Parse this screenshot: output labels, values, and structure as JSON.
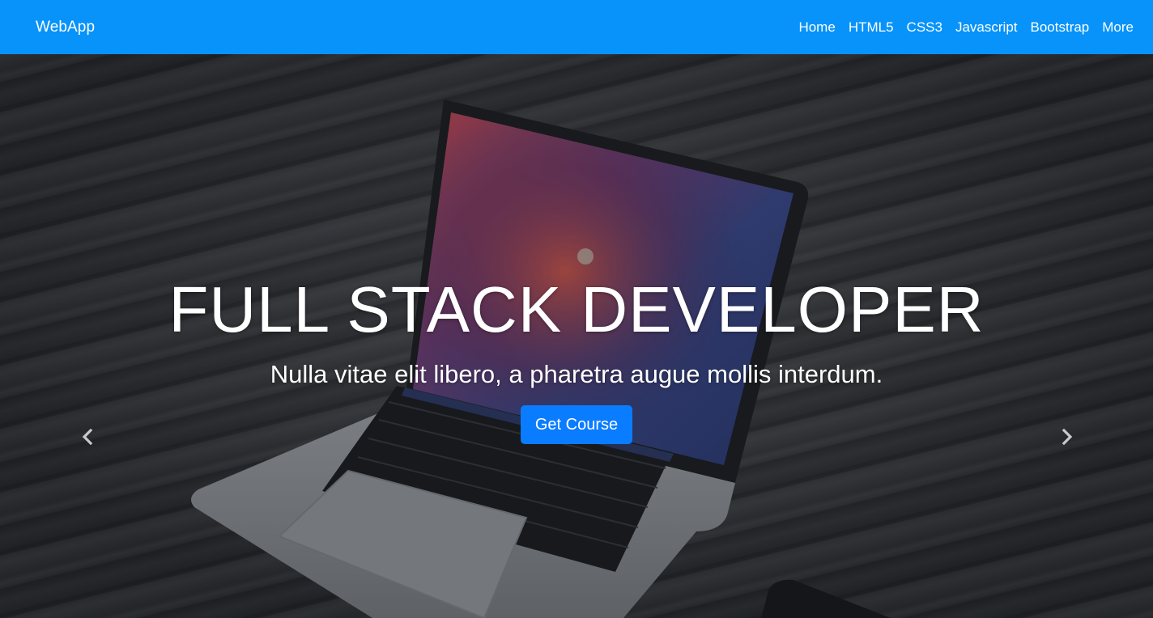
{
  "navbar": {
    "brand": "WebApp",
    "links": [
      "Home",
      "HTML5",
      "CSS3",
      "Javascript",
      "Bootstrap",
      "More"
    ],
    "background_color": "#0793fa"
  },
  "hero": {
    "title": "FULL STACK DEVELOPER",
    "subtitle": "Nulla vitae elit libero, a pharetra augue mollis interdum.",
    "button_label": "Get Course",
    "button_color": "#0a7cff",
    "prev_control_icon": "chevron-left-icon",
    "next_control_icon": "chevron-right-icon"
  }
}
